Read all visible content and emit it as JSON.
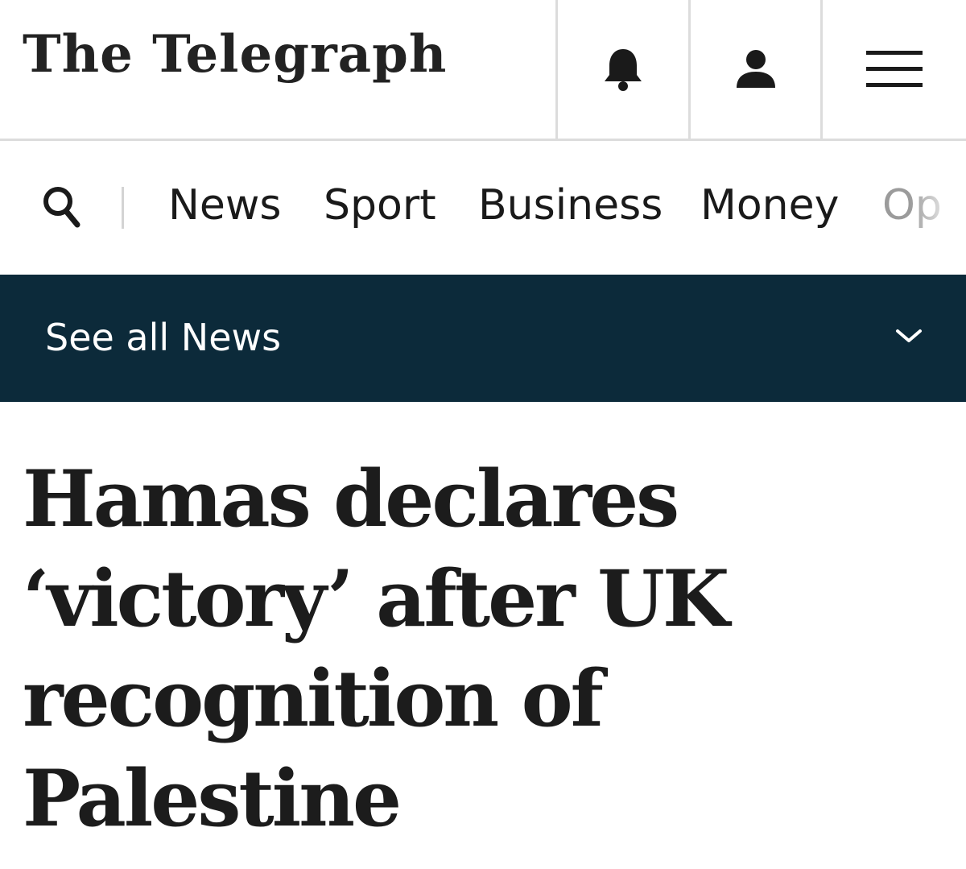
{
  "masthead": {
    "logo_text": "The Telegraph",
    "icons": [
      "bell-icon",
      "user-icon",
      "menu-icon"
    ]
  },
  "nav": {
    "search_icon": "search-icon",
    "items": [
      {
        "label": "News"
      },
      {
        "label": "Sport"
      },
      {
        "label": "Business"
      },
      {
        "label": "Money"
      },
      {
        "label": "Op"
      }
    ]
  },
  "section_bar": {
    "label": "See all News",
    "icon": "chevron-down-icon"
  },
  "article": {
    "headline_lines": [
      "Hamas declares",
      "‘victory’ after UK",
      "recognition of",
      "Palestine"
    ]
  },
  "colors": {
    "section_bar_bg": "#0c2a3a",
    "text": "#1a1a1a",
    "divider": "#dcdcdc"
  }
}
